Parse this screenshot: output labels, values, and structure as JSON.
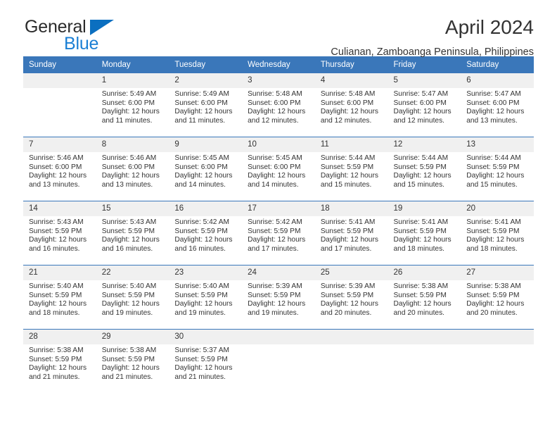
{
  "brand": {
    "line1": "General",
    "line2": "Blue",
    "triangle_color": "#0b6fc0",
    "line2_color": "#1b7fd4"
  },
  "header": {
    "title": "April 2024",
    "subtitle": "Culianan, Zamboanga Peninsula, Philippines"
  },
  "theme": {
    "header_bg": "#3a77ba",
    "header_text": "#ffffff",
    "daynum_bg": "#f0f0f0",
    "body_text": "#333333",
    "row_border": "#3a77ba"
  },
  "weekday_headers": [
    "Sunday",
    "Monday",
    "Tuesday",
    "Wednesday",
    "Thursday",
    "Friday",
    "Saturday"
  ],
  "labels": {
    "sunrise_prefix": "Sunrise:",
    "sunset_prefix": "Sunset:",
    "daylight_prefix": "Daylight:"
  },
  "weeks": [
    {
      "days": [
        {
          "num": "",
          "sunrise": "",
          "sunset": "",
          "daylight_l1": "",
          "daylight_l2": "",
          "empty": true
        },
        {
          "num": "1",
          "sunrise": "Sunrise: 5:49 AM",
          "sunset": "Sunset: 6:00 PM",
          "daylight_l1": "Daylight: 12 hours",
          "daylight_l2": "and 11 minutes."
        },
        {
          "num": "2",
          "sunrise": "Sunrise: 5:49 AM",
          "sunset": "Sunset: 6:00 PM",
          "daylight_l1": "Daylight: 12 hours",
          "daylight_l2": "and 11 minutes."
        },
        {
          "num": "3",
          "sunrise": "Sunrise: 5:48 AM",
          "sunset": "Sunset: 6:00 PM",
          "daylight_l1": "Daylight: 12 hours",
          "daylight_l2": "and 12 minutes."
        },
        {
          "num": "4",
          "sunrise": "Sunrise: 5:48 AM",
          "sunset": "Sunset: 6:00 PM",
          "daylight_l1": "Daylight: 12 hours",
          "daylight_l2": "and 12 minutes."
        },
        {
          "num": "5",
          "sunrise": "Sunrise: 5:47 AM",
          "sunset": "Sunset: 6:00 PM",
          "daylight_l1": "Daylight: 12 hours",
          "daylight_l2": "and 12 minutes."
        },
        {
          "num": "6",
          "sunrise": "Sunrise: 5:47 AM",
          "sunset": "Sunset: 6:00 PM",
          "daylight_l1": "Daylight: 12 hours",
          "daylight_l2": "and 13 minutes."
        }
      ]
    },
    {
      "days": [
        {
          "num": "7",
          "sunrise": "Sunrise: 5:46 AM",
          "sunset": "Sunset: 6:00 PM",
          "daylight_l1": "Daylight: 12 hours",
          "daylight_l2": "and 13 minutes."
        },
        {
          "num": "8",
          "sunrise": "Sunrise: 5:46 AM",
          "sunset": "Sunset: 6:00 PM",
          "daylight_l1": "Daylight: 12 hours",
          "daylight_l2": "and 13 minutes."
        },
        {
          "num": "9",
          "sunrise": "Sunrise: 5:45 AM",
          "sunset": "Sunset: 6:00 PM",
          "daylight_l1": "Daylight: 12 hours",
          "daylight_l2": "and 14 minutes."
        },
        {
          "num": "10",
          "sunrise": "Sunrise: 5:45 AM",
          "sunset": "Sunset: 6:00 PM",
          "daylight_l1": "Daylight: 12 hours",
          "daylight_l2": "and 14 minutes."
        },
        {
          "num": "11",
          "sunrise": "Sunrise: 5:44 AM",
          "sunset": "Sunset: 5:59 PM",
          "daylight_l1": "Daylight: 12 hours",
          "daylight_l2": "and 15 minutes."
        },
        {
          "num": "12",
          "sunrise": "Sunrise: 5:44 AM",
          "sunset": "Sunset: 5:59 PM",
          "daylight_l1": "Daylight: 12 hours",
          "daylight_l2": "and 15 minutes."
        },
        {
          "num": "13",
          "sunrise": "Sunrise: 5:44 AM",
          "sunset": "Sunset: 5:59 PM",
          "daylight_l1": "Daylight: 12 hours",
          "daylight_l2": "and 15 minutes."
        }
      ]
    },
    {
      "days": [
        {
          "num": "14",
          "sunrise": "Sunrise: 5:43 AM",
          "sunset": "Sunset: 5:59 PM",
          "daylight_l1": "Daylight: 12 hours",
          "daylight_l2": "and 16 minutes."
        },
        {
          "num": "15",
          "sunrise": "Sunrise: 5:43 AM",
          "sunset": "Sunset: 5:59 PM",
          "daylight_l1": "Daylight: 12 hours",
          "daylight_l2": "and 16 minutes."
        },
        {
          "num": "16",
          "sunrise": "Sunrise: 5:42 AM",
          "sunset": "Sunset: 5:59 PM",
          "daylight_l1": "Daylight: 12 hours",
          "daylight_l2": "and 16 minutes."
        },
        {
          "num": "17",
          "sunrise": "Sunrise: 5:42 AM",
          "sunset": "Sunset: 5:59 PM",
          "daylight_l1": "Daylight: 12 hours",
          "daylight_l2": "and 17 minutes."
        },
        {
          "num": "18",
          "sunrise": "Sunrise: 5:41 AM",
          "sunset": "Sunset: 5:59 PM",
          "daylight_l1": "Daylight: 12 hours",
          "daylight_l2": "and 17 minutes."
        },
        {
          "num": "19",
          "sunrise": "Sunrise: 5:41 AM",
          "sunset": "Sunset: 5:59 PM",
          "daylight_l1": "Daylight: 12 hours",
          "daylight_l2": "and 18 minutes."
        },
        {
          "num": "20",
          "sunrise": "Sunrise: 5:41 AM",
          "sunset": "Sunset: 5:59 PM",
          "daylight_l1": "Daylight: 12 hours",
          "daylight_l2": "and 18 minutes."
        }
      ]
    },
    {
      "days": [
        {
          "num": "21",
          "sunrise": "Sunrise: 5:40 AM",
          "sunset": "Sunset: 5:59 PM",
          "daylight_l1": "Daylight: 12 hours",
          "daylight_l2": "and 18 minutes."
        },
        {
          "num": "22",
          "sunrise": "Sunrise: 5:40 AM",
          "sunset": "Sunset: 5:59 PM",
          "daylight_l1": "Daylight: 12 hours",
          "daylight_l2": "and 19 minutes."
        },
        {
          "num": "23",
          "sunrise": "Sunrise: 5:40 AM",
          "sunset": "Sunset: 5:59 PM",
          "daylight_l1": "Daylight: 12 hours",
          "daylight_l2": "and 19 minutes."
        },
        {
          "num": "24",
          "sunrise": "Sunrise: 5:39 AM",
          "sunset": "Sunset: 5:59 PM",
          "daylight_l1": "Daylight: 12 hours",
          "daylight_l2": "and 19 minutes."
        },
        {
          "num": "25",
          "sunrise": "Sunrise: 5:39 AM",
          "sunset": "Sunset: 5:59 PM",
          "daylight_l1": "Daylight: 12 hours",
          "daylight_l2": "and 20 minutes."
        },
        {
          "num": "26",
          "sunrise": "Sunrise: 5:38 AM",
          "sunset": "Sunset: 5:59 PM",
          "daylight_l1": "Daylight: 12 hours",
          "daylight_l2": "and 20 minutes."
        },
        {
          "num": "27",
          "sunrise": "Sunrise: 5:38 AM",
          "sunset": "Sunset: 5:59 PM",
          "daylight_l1": "Daylight: 12 hours",
          "daylight_l2": "and 20 minutes."
        }
      ]
    },
    {
      "days": [
        {
          "num": "28",
          "sunrise": "Sunrise: 5:38 AM",
          "sunset": "Sunset: 5:59 PM",
          "daylight_l1": "Daylight: 12 hours",
          "daylight_l2": "and 21 minutes."
        },
        {
          "num": "29",
          "sunrise": "Sunrise: 5:38 AM",
          "sunset": "Sunset: 5:59 PM",
          "daylight_l1": "Daylight: 12 hours",
          "daylight_l2": "and 21 minutes."
        },
        {
          "num": "30",
          "sunrise": "Sunrise: 5:37 AM",
          "sunset": "Sunset: 5:59 PM",
          "daylight_l1": "Daylight: 12 hours",
          "daylight_l2": "and 21 minutes."
        },
        {
          "num": "",
          "sunrise": "",
          "sunset": "",
          "daylight_l1": "",
          "daylight_l2": "",
          "empty": true
        },
        {
          "num": "",
          "sunrise": "",
          "sunset": "",
          "daylight_l1": "",
          "daylight_l2": "",
          "empty": true
        },
        {
          "num": "",
          "sunrise": "",
          "sunset": "",
          "daylight_l1": "",
          "daylight_l2": "",
          "empty": true
        },
        {
          "num": "",
          "sunrise": "",
          "sunset": "",
          "daylight_l1": "",
          "daylight_l2": "",
          "empty": true
        }
      ]
    }
  ]
}
